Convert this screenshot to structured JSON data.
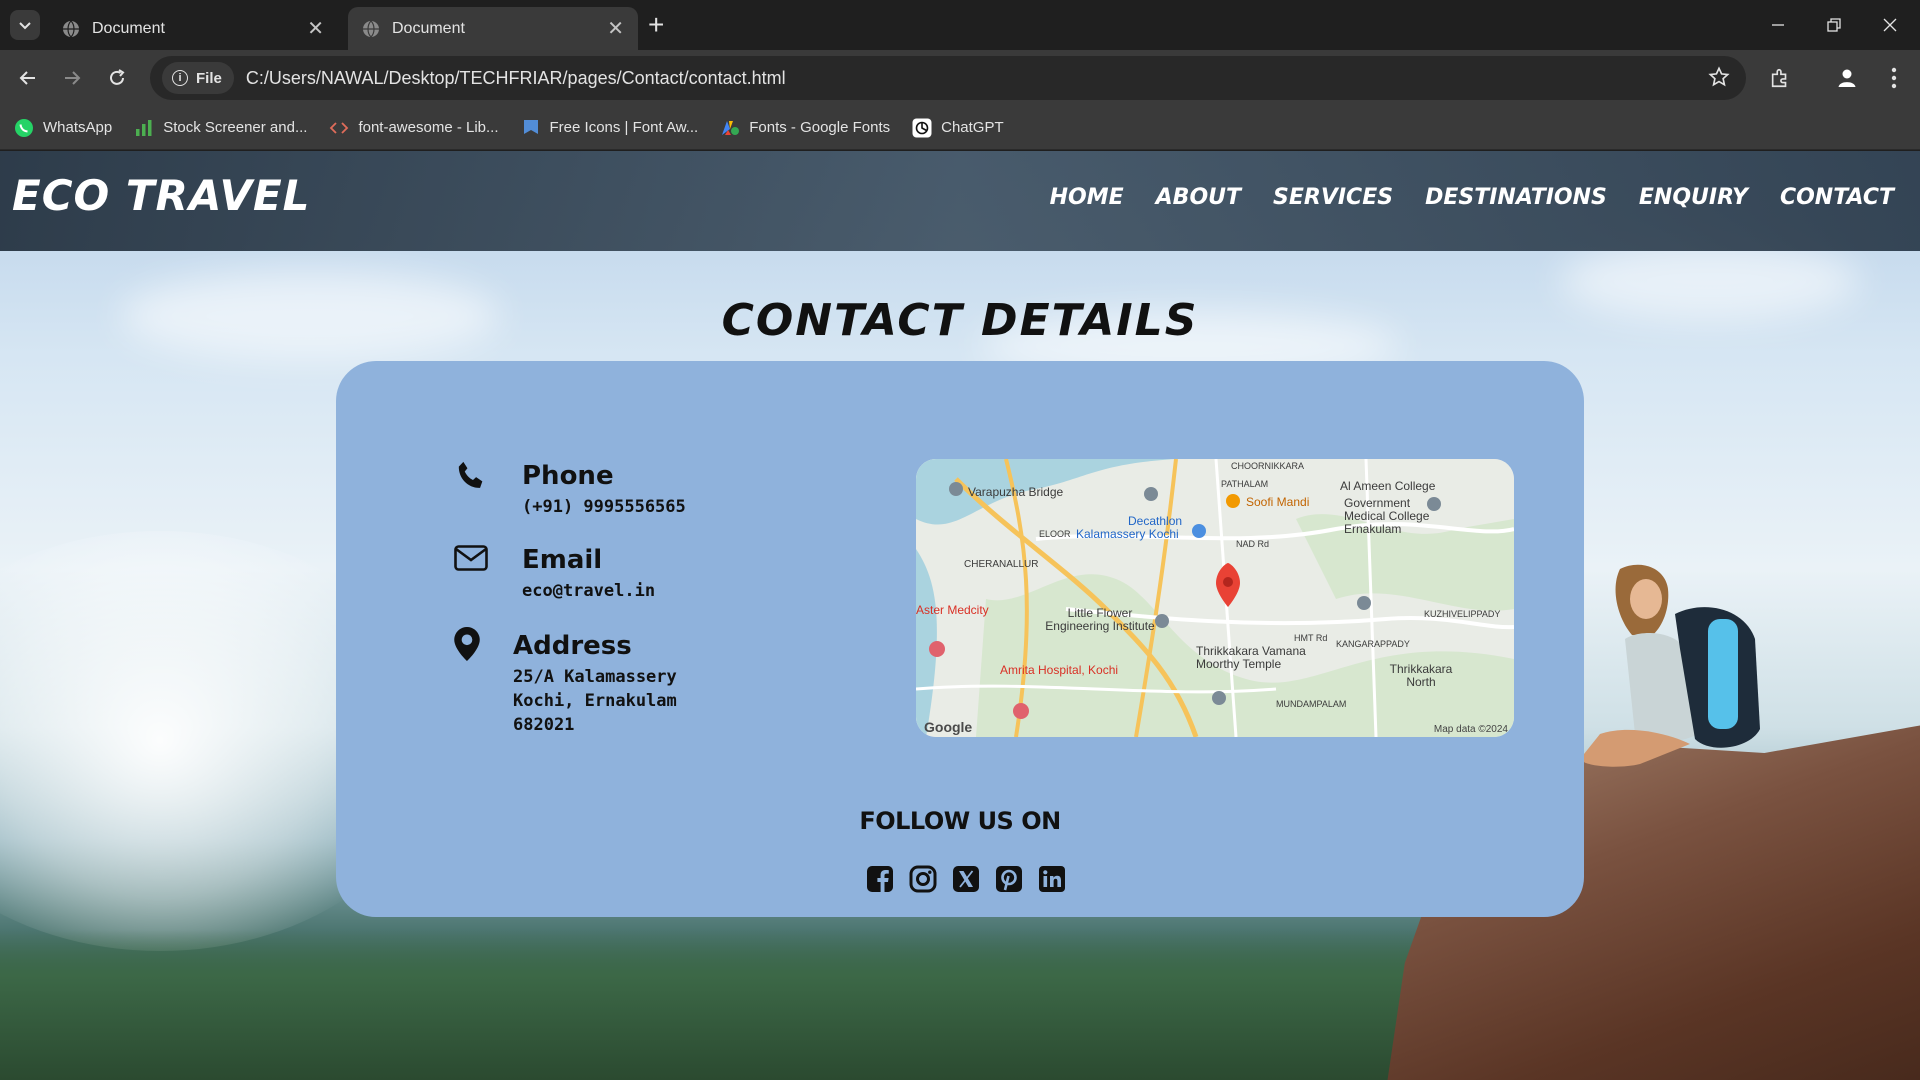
{
  "browser": {
    "tabs": [
      {
        "title": "Document",
        "active": false
      },
      {
        "title": "Document",
        "active": true
      }
    ],
    "omnibox": {
      "scheme_label": "File",
      "url": "C:/Users/NAWAL/Desktop/TECHFRIAR/pages/Contact/contact.html"
    },
    "bookmarks": [
      {
        "label": "WhatsApp",
        "icon": "whatsapp-icon"
      },
      {
        "label": "Stock Screener and...",
        "icon": "bar-chart-icon"
      },
      {
        "label": "font-awesome - Lib...",
        "icon": "code-icon"
      },
      {
        "label": "Free Icons | Font Aw...",
        "icon": "flag-icon"
      },
      {
        "label": "Fonts - Google Fonts",
        "icon": "google-fonts-icon"
      },
      {
        "label": "ChatGPT",
        "icon": "chatgpt-icon"
      }
    ]
  },
  "site": {
    "brand": "ECO TRAVEL",
    "nav": [
      {
        "label": "HOME"
      },
      {
        "label": "ABOUT"
      },
      {
        "label": "SERVICES"
      },
      {
        "label": "DESTINATIONS"
      },
      {
        "label": "ENQUIRY"
      },
      {
        "label": "CONTACT"
      }
    ]
  },
  "contact": {
    "title": "CONTACT DETAILS",
    "phone": {
      "label": "Phone",
      "value": "(+91) 9995556565"
    },
    "email": {
      "label": "Email",
      "value": "eco@travel.in"
    },
    "address": {
      "label": "Address",
      "lines": [
        "25/A Kalamassery",
        "Kochi, Ernakulam",
        "682021"
      ]
    },
    "map": {
      "labels": [
        "Varapuzha Bridge",
        "Kalamassery Kochi",
        "Decathlon",
        "Soofi Mandi",
        "Al Ameen College",
        "Government Medical College Ernakulam",
        "CHERANALLUR",
        "Aster Medcity",
        "Little Flower Engineering Institute",
        "Thrikkakara Vamana Moorthy Temple",
        "Amrita Hospital, Kochi",
        "Thrikkakara North",
        "KANGARAPPADY",
        "KUZHIVELIPPADY",
        "MUNDAMPALAM",
        "PATHALAM",
        "CHOORNIKKARA",
        "ELOOR",
        "HMT Rd",
        "NAD Rd"
      ],
      "google_label": "Google",
      "attribution": "Map data ©2024"
    },
    "follow_title": "FOLLOW US ON",
    "socials": [
      "facebook-icon",
      "instagram-icon",
      "x-twitter-icon",
      "pinterest-icon",
      "linkedin-icon"
    ]
  },
  "colors": {
    "card_bg": "#8fb2dc",
    "nav_bg": "#2c3d4f",
    "text_dark": "#111111",
    "chrome_bg": "#1f1f1f",
    "chrome_toolbar": "#3a3a3a"
  }
}
